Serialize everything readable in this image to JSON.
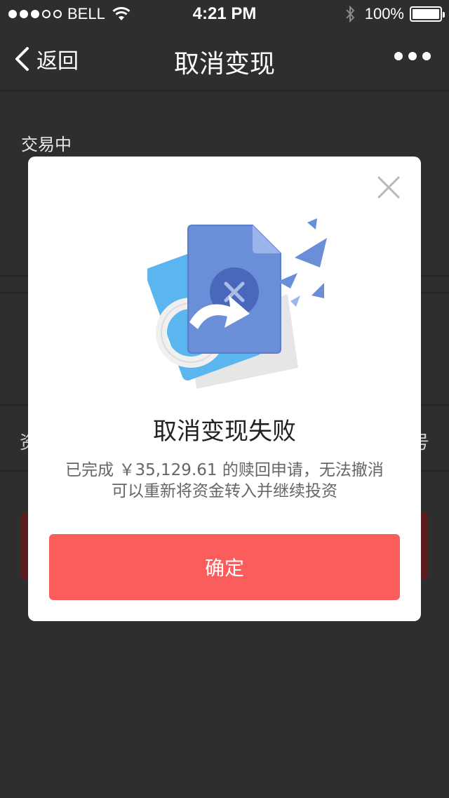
{
  "status_bar": {
    "carrier": "BELL",
    "time": "4:21 PM",
    "battery": "100%",
    "signal_bars_filled": 3,
    "signal_bars_total": 5
  },
  "nav": {
    "back_label": "返回",
    "title": "取消变现"
  },
  "background_page": {
    "status_text": "交易中",
    "row_left_fragment": "资",
    "row_right_fragment": "号"
  },
  "dialog": {
    "title": "取消变现失败",
    "message_line1": "已完成 ￥35,129.61 的赎回申请，无法撤消",
    "message_line2": "可以重新将资金转入并继续投资",
    "confirm_label": "确定"
  },
  "colors": {
    "overlay_bg": "#2e2e2e",
    "dialog_bg": "#ffffff",
    "confirm_button": "#fb5c5c",
    "illustration_doc": "#6a8fd8",
    "illustration_card": "#5bb6ef"
  },
  "icons": [
    "wifi-icon",
    "bluetooth-icon",
    "battery-icon",
    "back-chevron-icon",
    "more-icon",
    "close-icon",
    "cancel-document-icon"
  ]
}
